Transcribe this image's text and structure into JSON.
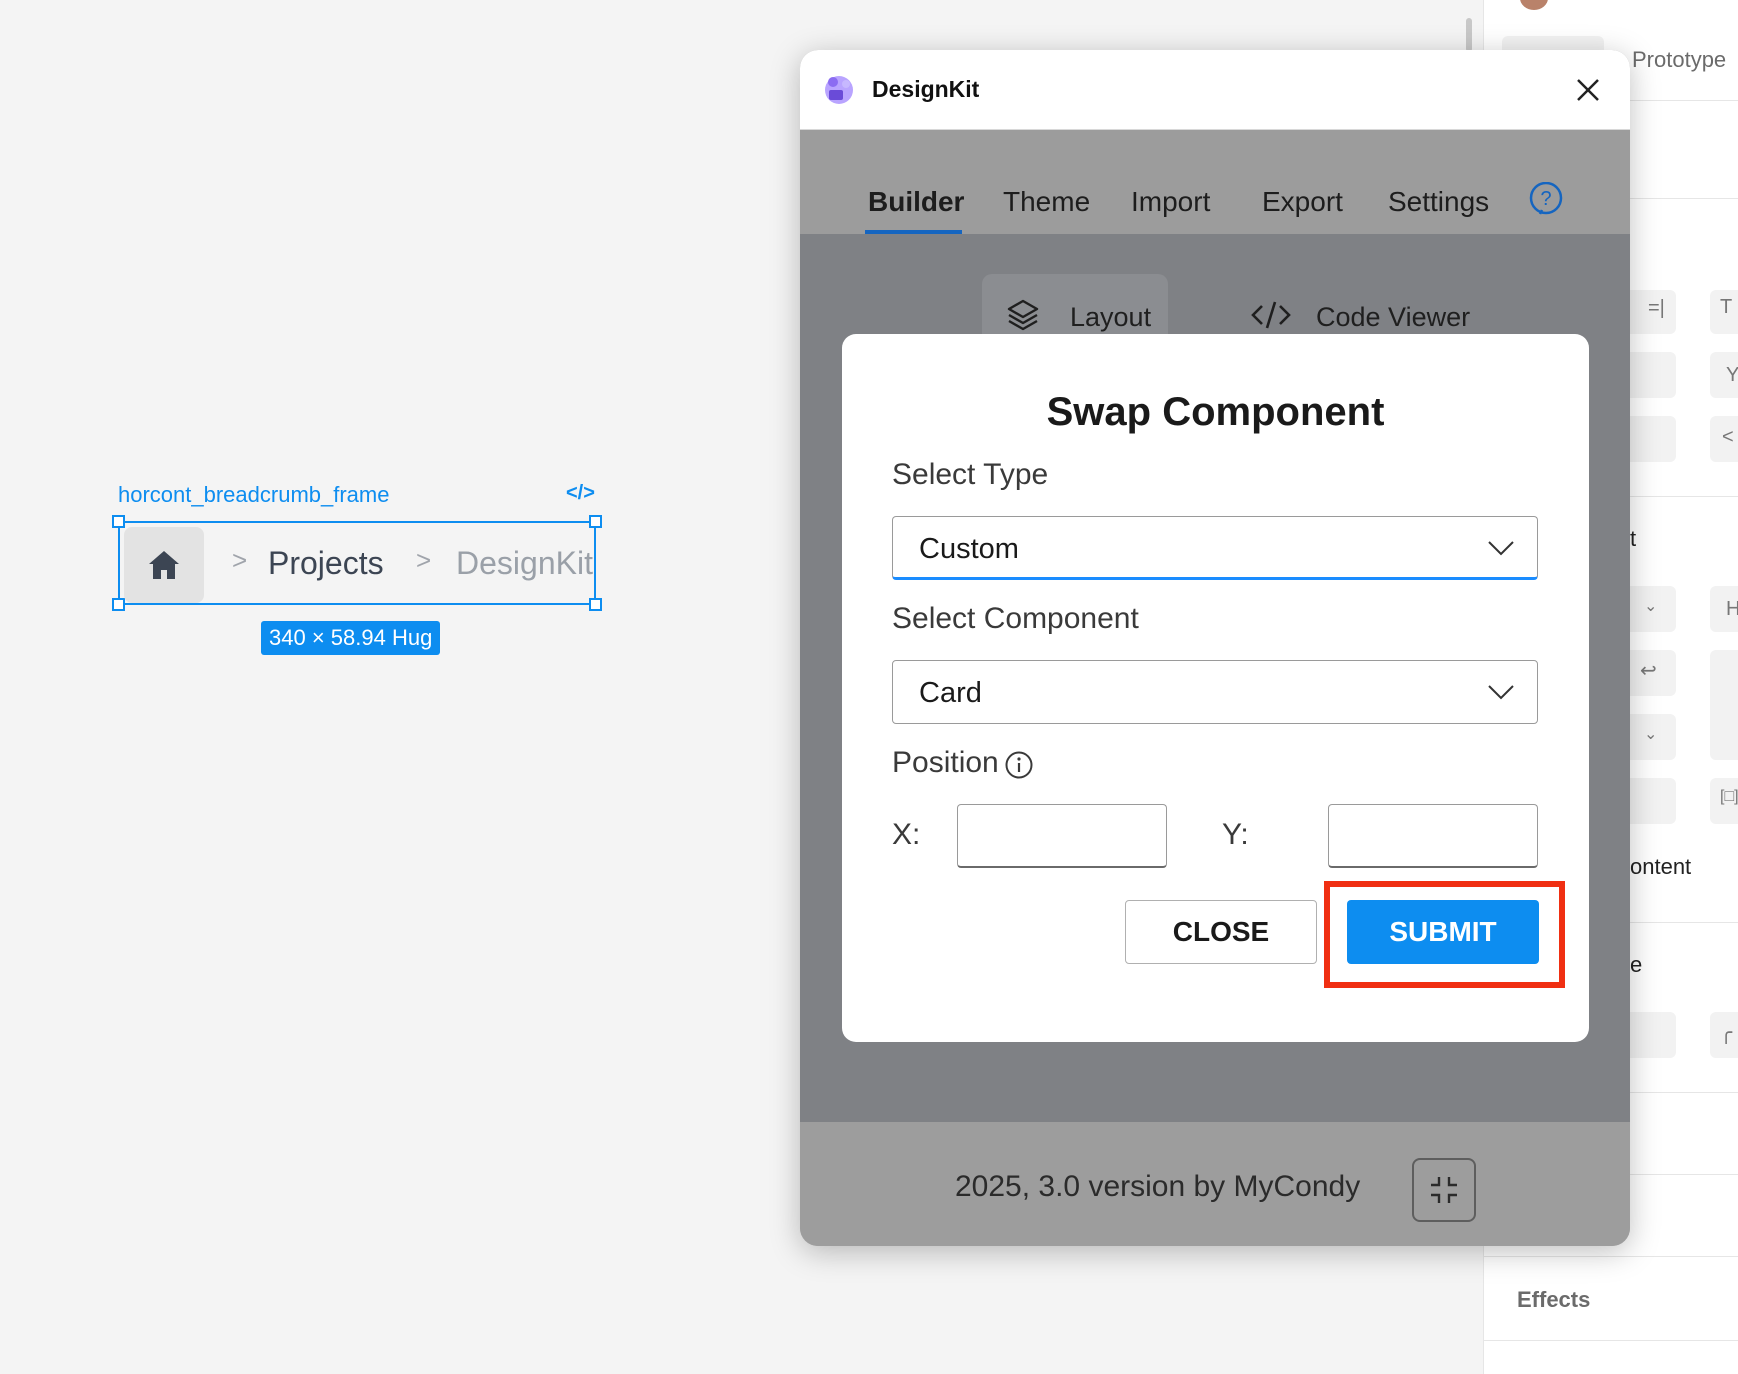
{
  "canvas": {
    "selection_label": "horcont_breadcrumb_frame",
    "code_icon": "code-icon",
    "breadcrumb": {
      "home_icon": "home-icon",
      "separator": ">",
      "items": [
        "Projects",
        "DesignKit"
      ]
    },
    "size_badge": "340 × 58.94 Hug"
  },
  "right_panel": {
    "tab_prototype": "Prototype",
    "partial_t": "t",
    "partial_content": "ontent",
    "partial_e": "e",
    "partial_Y": "Y",
    "partial_H": "H",
    "effects_label": "Effects"
  },
  "plugin": {
    "app_name": "DesignKit",
    "tabs": [
      "Builder",
      "Theme",
      "Import",
      "Export",
      "Settings"
    ],
    "active_tab": "Builder",
    "subtabs": [
      "Layout",
      "Code Viewer"
    ],
    "footer_text": "2025, 3.0 version by MyCondy"
  },
  "modal": {
    "title": "Swap Component",
    "select_type_label": "Select Type",
    "select_type_value": "Custom",
    "select_component_label": "Select Component",
    "select_component_value": "Card",
    "position_label": "Position",
    "x_label": "X:",
    "y_label": "Y:",
    "x_value": "",
    "y_value": "",
    "close_label": "CLOSE",
    "submit_label": "SUBMIT"
  },
  "colors": {
    "accent": "#0d8df0",
    "highlight": "#f02f12",
    "tab_underline": "#1565c0"
  }
}
